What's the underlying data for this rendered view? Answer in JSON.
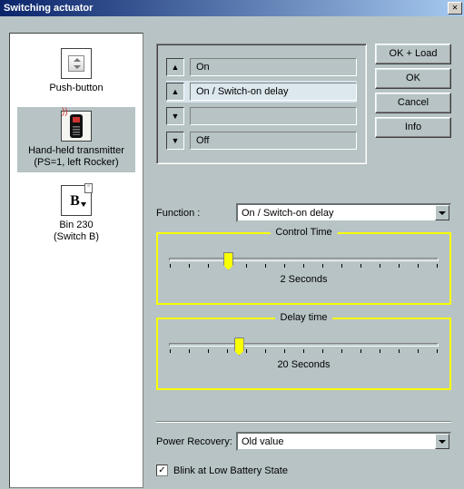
{
  "window": {
    "title": "Switching actuator",
    "close_glyph": "✕"
  },
  "sidebar": {
    "items": [
      {
        "label": "Push-button",
        "selected": false
      },
      {
        "label": "Hand-held transmitter\n(PS=1, left Rocker)",
        "selected": true
      },
      {
        "label": "Bin 230\n(Switch B)",
        "selected": false
      }
    ]
  },
  "buttons": {
    "ok_load": "OK + Load",
    "ok": "OK",
    "cancel": "Cancel",
    "info": "Info"
  },
  "modes": [
    {
      "icon": "up-arrow-icon",
      "label": "On",
      "selected": false
    },
    {
      "icon": "up-arrow-icon",
      "label": "On / Switch-on delay",
      "selected": true
    },
    {
      "icon": "down-arrow-icon",
      "label": "",
      "selected": false
    },
    {
      "icon": "down-arrow-icon",
      "label": "Off",
      "selected": false
    }
  ],
  "function": {
    "label": "Function :",
    "value": "On / Switch-on delay"
  },
  "control_time": {
    "title": "Control Time",
    "value_text": "2 Seconds",
    "thumb_pct": 20
  },
  "delay_time": {
    "title": "Delay time",
    "value_text": "20 Seconds",
    "thumb_pct": 24
  },
  "power_recovery": {
    "label": "Power Recovery:",
    "value": "Old value"
  },
  "blink": {
    "label": "Blink at Low Battery State",
    "checked": true,
    "mark": "✓"
  }
}
